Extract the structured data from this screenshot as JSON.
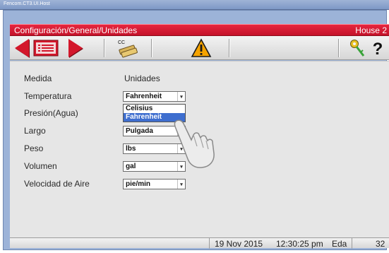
{
  "host_window": {
    "title": "Fencom.CT3.UI.Host"
  },
  "header": {
    "breadcrumb": "Configuración/General/Unidades",
    "house": "House 2"
  },
  "toolbar": {
    "cc_label": "CC"
  },
  "content": {
    "col_medida": "Medida",
    "col_unidades": "Unidades",
    "rows": [
      {
        "label": "Temperatura",
        "value": "Fahrenheit"
      },
      {
        "label": "Presión(Agua)",
        "value": ""
      },
      {
        "label": "Largo",
        "value": "Pulgada"
      },
      {
        "label": "Peso",
        "value": "lbs"
      },
      {
        "label": "Volumen",
        "value": "gal"
      },
      {
        "label": "Velocidad de Aire",
        "value": "pie/min"
      }
    ],
    "dropdown_options": [
      "Celisius",
      "Fahrenheit"
    ],
    "dropdown_highlighted": "Fahrenheit"
  },
  "status": {
    "date": "19 Nov 2015",
    "time": "12:30:25 pm",
    "mode": "Eda",
    "number": "32"
  },
  "colors": {
    "header_red": "#d3172b",
    "highlight_blue": "#3e6ecf",
    "frame_blue": "#9cb3d8"
  }
}
